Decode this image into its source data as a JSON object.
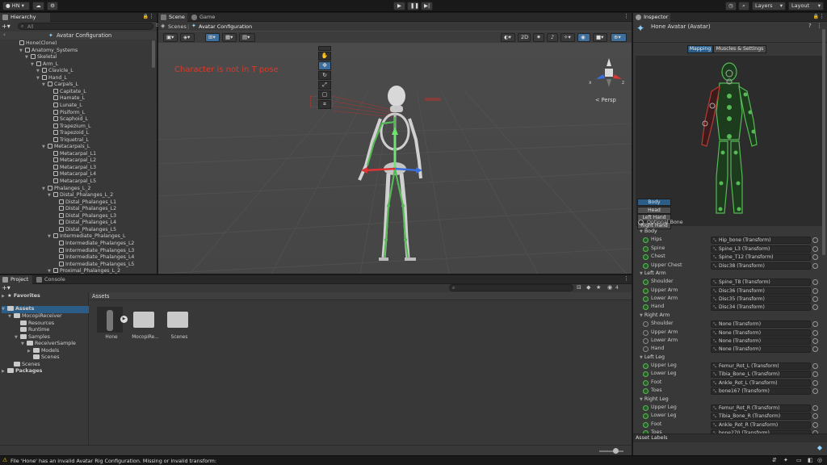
{
  "toolbar": {
    "account": "HN",
    "layers": "Layers",
    "layout": "Layout"
  },
  "hierarchy": {
    "tab": "Hierarchy",
    "search_placeholder": "All",
    "header": "Avatar Configuration",
    "rows": [
      {
        "label": "Hone(Clone)",
        "depth": 1
      },
      {
        "label": "Anatomy_Systems",
        "depth": 2
      },
      {
        "label": "Skeletal",
        "depth": 3
      },
      {
        "label": "Arm_L",
        "depth": 4
      },
      {
        "label": "Clavicle_L",
        "depth": 5
      },
      {
        "label": "Hand_L",
        "depth": 5
      },
      {
        "label": "Carpals_L",
        "depth": 6
      },
      {
        "label": "Capitate_L",
        "depth": 7
      },
      {
        "label": "Hamate_L",
        "depth": 7
      },
      {
        "label": "Lunate_L",
        "depth": 7
      },
      {
        "label": "Pisiform_L",
        "depth": 7
      },
      {
        "label": "Scaphoid_L",
        "depth": 7
      },
      {
        "label": "Trapezium_L",
        "depth": 7
      },
      {
        "label": "Trapezoid_L",
        "depth": 7
      },
      {
        "label": "Triquetral_L",
        "depth": 7
      },
      {
        "label": "Metacarpals_L",
        "depth": 6
      },
      {
        "label": "Metacarpal_L1",
        "depth": 7
      },
      {
        "label": "Metacarpal_L2",
        "depth": 7
      },
      {
        "label": "Metacarpal_L3",
        "depth": 7
      },
      {
        "label": "Metacarpal_L4",
        "depth": 7
      },
      {
        "label": "Metacarpal_L5",
        "depth": 7
      },
      {
        "label": "Phalanges_L_2",
        "depth": 6
      },
      {
        "label": "Distal_Phalanges_L_2",
        "depth": 7
      },
      {
        "label": "Distal_Phalanges_L1",
        "depth": 8
      },
      {
        "label": "Distal_Phalanges_L2",
        "depth": 8
      },
      {
        "label": "Distal_Phalanges_L3",
        "depth": 8
      },
      {
        "label": "Distal_Phalanges_L4",
        "depth": 8
      },
      {
        "label": "Distal_Phalanges_L5",
        "depth": 8
      },
      {
        "label": "Intermediate_Phalanges_L",
        "depth": 7
      },
      {
        "label": "Intermediate_Phalanges_L2",
        "depth": 8
      },
      {
        "label": "Intermediate_Phalanges_L3",
        "depth": 8
      },
      {
        "label": "Intermediate_Phalanges_L4",
        "depth": 8
      },
      {
        "label": "Intermediate_Phalanges_L5",
        "depth": 8
      },
      {
        "label": "Proximal_Phalanges_L_2",
        "depth": 7
      }
    ]
  },
  "scene": {
    "tabs": [
      "Scene",
      "Game"
    ],
    "breadcrumb_root": "Scenes",
    "breadcrumb_current": "Avatar Configuration",
    "mode_2d": "2D",
    "warning_text": "Character is not in T pose",
    "persp_label": "< Persp",
    "gizmo_x": "x",
    "gizmo_z": "z"
  },
  "project": {
    "tabs": [
      "Project",
      "Console"
    ],
    "favorites": "Favorites",
    "assets_header": "Assets",
    "tree": [
      {
        "label": "Assets",
        "depth": 0,
        "selected": true
      },
      {
        "label": "MocopiReceiver",
        "depth": 1
      },
      {
        "label": "Resources",
        "depth": 2
      },
      {
        "label": "Runtime",
        "depth": 2
      },
      {
        "label": "Samples",
        "depth": 2
      },
      {
        "label": "ReceiverSample",
        "depth": 3
      },
      {
        "label": "Models",
        "depth": 4
      },
      {
        "label": "Scenes",
        "depth": 4
      },
      {
        "label": "Scenes",
        "depth": 1
      },
      {
        "label": "Packages",
        "depth": 0
      }
    ],
    "items": [
      {
        "label": "Hone",
        "kind": "model"
      },
      {
        "label": "MocopiRe...",
        "kind": "folder"
      },
      {
        "label": "Scenes",
        "kind": "folder"
      }
    ],
    "hidden_count": "4"
  },
  "inspector": {
    "tab": "Inspector",
    "title": "Hone Avatar (Avatar)",
    "subtabs": [
      "Mapping",
      "Muscles & Settings"
    ],
    "view_buttons": [
      "Body",
      "Head",
      "Left Hand",
      "Right Hand"
    ],
    "optional_bone": "Optional Bone",
    "groups": [
      {
        "name": "Body",
        "bones": [
          {
            "label": "Hips",
            "value": "Hip_bone (Transform)",
            "set": true
          },
          {
            "label": "Spine",
            "value": "Spine_L3 (Transform)",
            "set": true
          },
          {
            "label": "Chest",
            "value": "Spine_T12 (Transform)",
            "set": true
          },
          {
            "label": "Upper Chest",
            "value": "Disc38 (Transform)",
            "set": true
          }
        ]
      },
      {
        "name": "Left Arm",
        "bones": [
          {
            "label": "Shoulder",
            "value": "Spine_T8 (Transform)",
            "set": true
          },
          {
            "label": "Upper Arm",
            "value": "Disc36 (Transform)",
            "set": true
          },
          {
            "label": "Lower Arm",
            "value": "Disc35 (Transform)",
            "set": true
          },
          {
            "label": "Hand",
            "value": "Disc34 (Transform)",
            "set": true
          }
        ]
      },
      {
        "name": "Right Arm",
        "bones": [
          {
            "label": "Shoulder",
            "value": "None (Transform)",
            "set": false
          },
          {
            "label": "Upper Arm",
            "value": "None (Transform)",
            "set": false
          },
          {
            "label": "Lower Arm",
            "value": "None (Transform)",
            "set": false
          },
          {
            "label": "Hand",
            "value": "None (Transform)",
            "set": false
          }
        ]
      },
      {
        "name": "Left Leg",
        "bones": [
          {
            "label": "Upper Leg",
            "value": "Femur_Rot_L (Transform)",
            "set": true
          },
          {
            "label": "Lower Leg",
            "value": "Tibia_Bone_L (Transform)",
            "set": true
          },
          {
            "label": "Foot",
            "value": "Ankle_Rot_L (Transform)",
            "set": true
          },
          {
            "label": "Toes",
            "value": "bone167 (Transform)",
            "set": true
          }
        ]
      },
      {
        "name": "Right Leg",
        "bones": [
          {
            "label": "Upper Leg",
            "value": "Femur_Rot_R (Transform)",
            "set": true
          },
          {
            "label": "Lower Leg",
            "value": "Tibia_Bone_R (Transform)",
            "set": true
          },
          {
            "label": "Foot",
            "value": "Ankle_Rot_R (Transform)",
            "set": true
          },
          {
            "label": "Toes",
            "value": "bone270 (Transform)",
            "set": true
          }
        ]
      }
    ],
    "asset_labels": "Asset Labels"
  },
  "status": {
    "message": "File 'Hone' has an invalid Avatar Rig Configuration. Missing or invalid transform:"
  },
  "colors": {
    "accent_blue": "#2c5d87",
    "bone_green": "#56b956",
    "bone_red": "#b83a34",
    "warning_red": "#d83a2a"
  }
}
